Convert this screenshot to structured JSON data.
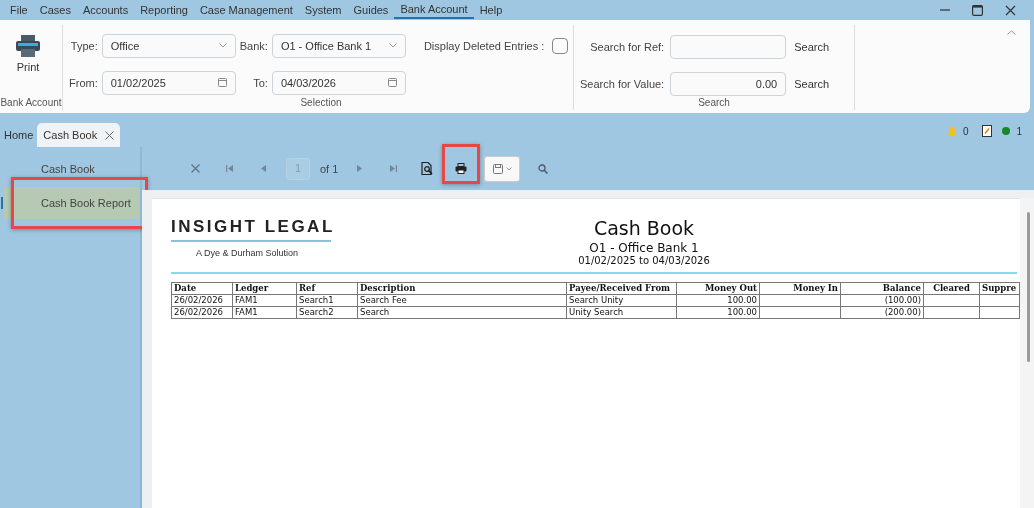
{
  "menu": [
    {
      "label": "File",
      "selected": false
    },
    {
      "label": "Cases",
      "selected": false
    },
    {
      "label": "Accounts",
      "selected": false
    },
    {
      "label": "Reporting",
      "selected": false
    },
    {
      "label": "Case Management",
      "selected": false
    },
    {
      "label": "System",
      "selected": false
    },
    {
      "label": "Guides",
      "selected": false
    },
    {
      "label": "Bank Account",
      "selected": true
    },
    {
      "label": "Help",
      "selected": false
    }
  ],
  "ribbon": {
    "print_label": "Print",
    "group_bank": "Bank Account",
    "group_selection": "Selection",
    "group_search": "Search",
    "type_label": "Type:",
    "type_value": "Office",
    "bank_label": "Bank:",
    "bank_value": "O1 - Office Bank 1",
    "deleted_label": "Display Deleted Entries :",
    "deleted_checked": false,
    "from_label": "From:",
    "from_value": "01/02/2025",
    "to_label": "To:",
    "to_value": "04/03/2026",
    "ref_label": "Search for Ref:",
    "ref_button": "Search",
    "value_label": "Search for Value:",
    "value_value": "0.00",
    "value_button": "Search"
  },
  "tabs": [
    {
      "label": "Home",
      "selected": false,
      "closable": false
    },
    {
      "label": "Cash Book",
      "selected": true,
      "closable": true
    }
  ],
  "status": {
    "alerts": "0",
    "online": "1"
  },
  "sidebar": [
    {
      "label": "Cash Book",
      "selected": false,
      "highlighted": false
    },
    {
      "label": "Cash Book Report",
      "selected": true,
      "highlighted": true
    }
  ],
  "toolbar": {
    "page": "1",
    "of": "of 1",
    "print_highlighted": true
  },
  "report": {
    "logo": "INSIGHT LEGAL",
    "tagline": "A Dye & Durham Solution",
    "title": "Cash Book",
    "subtitle": "O1 - Office Bank 1",
    "period": "01/02/2025 to 04/03/2026",
    "columns": [
      {
        "label": "Date",
        "kind": "text"
      },
      {
        "label": "Ledger",
        "kind": "text"
      },
      {
        "label": "Ref",
        "kind": "text"
      },
      {
        "label": "Description",
        "kind": "text"
      },
      {
        "label": "Payee/Received From",
        "kind": "text"
      },
      {
        "label": "Money Out",
        "kind": "amount"
      },
      {
        "label": "Money In",
        "kind": "amount"
      },
      {
        "label": "Balance",
        "kind": "amount"
      },
      {
        "label": "Cleared",
        "kind": "flag"
      },
      {
        "label": "Suppre",
        "kind": "text"
      }
    ],
    "rows": [
      [
        "26/02/2026",
        "FAM1",
        "Search1",
        "Search Fee",
        "Search Unity",
        "100.00",
        "",
        "(100.00)",
        "",
        ""
      ],
      [
        "26/02/2026",
        "FAM1",
        "Search2",
        "Search",
        "Unity Search",
        "100.00",
        "",
        "(200.00)",
        "",
        ""
      ]
    ]
  }
}
